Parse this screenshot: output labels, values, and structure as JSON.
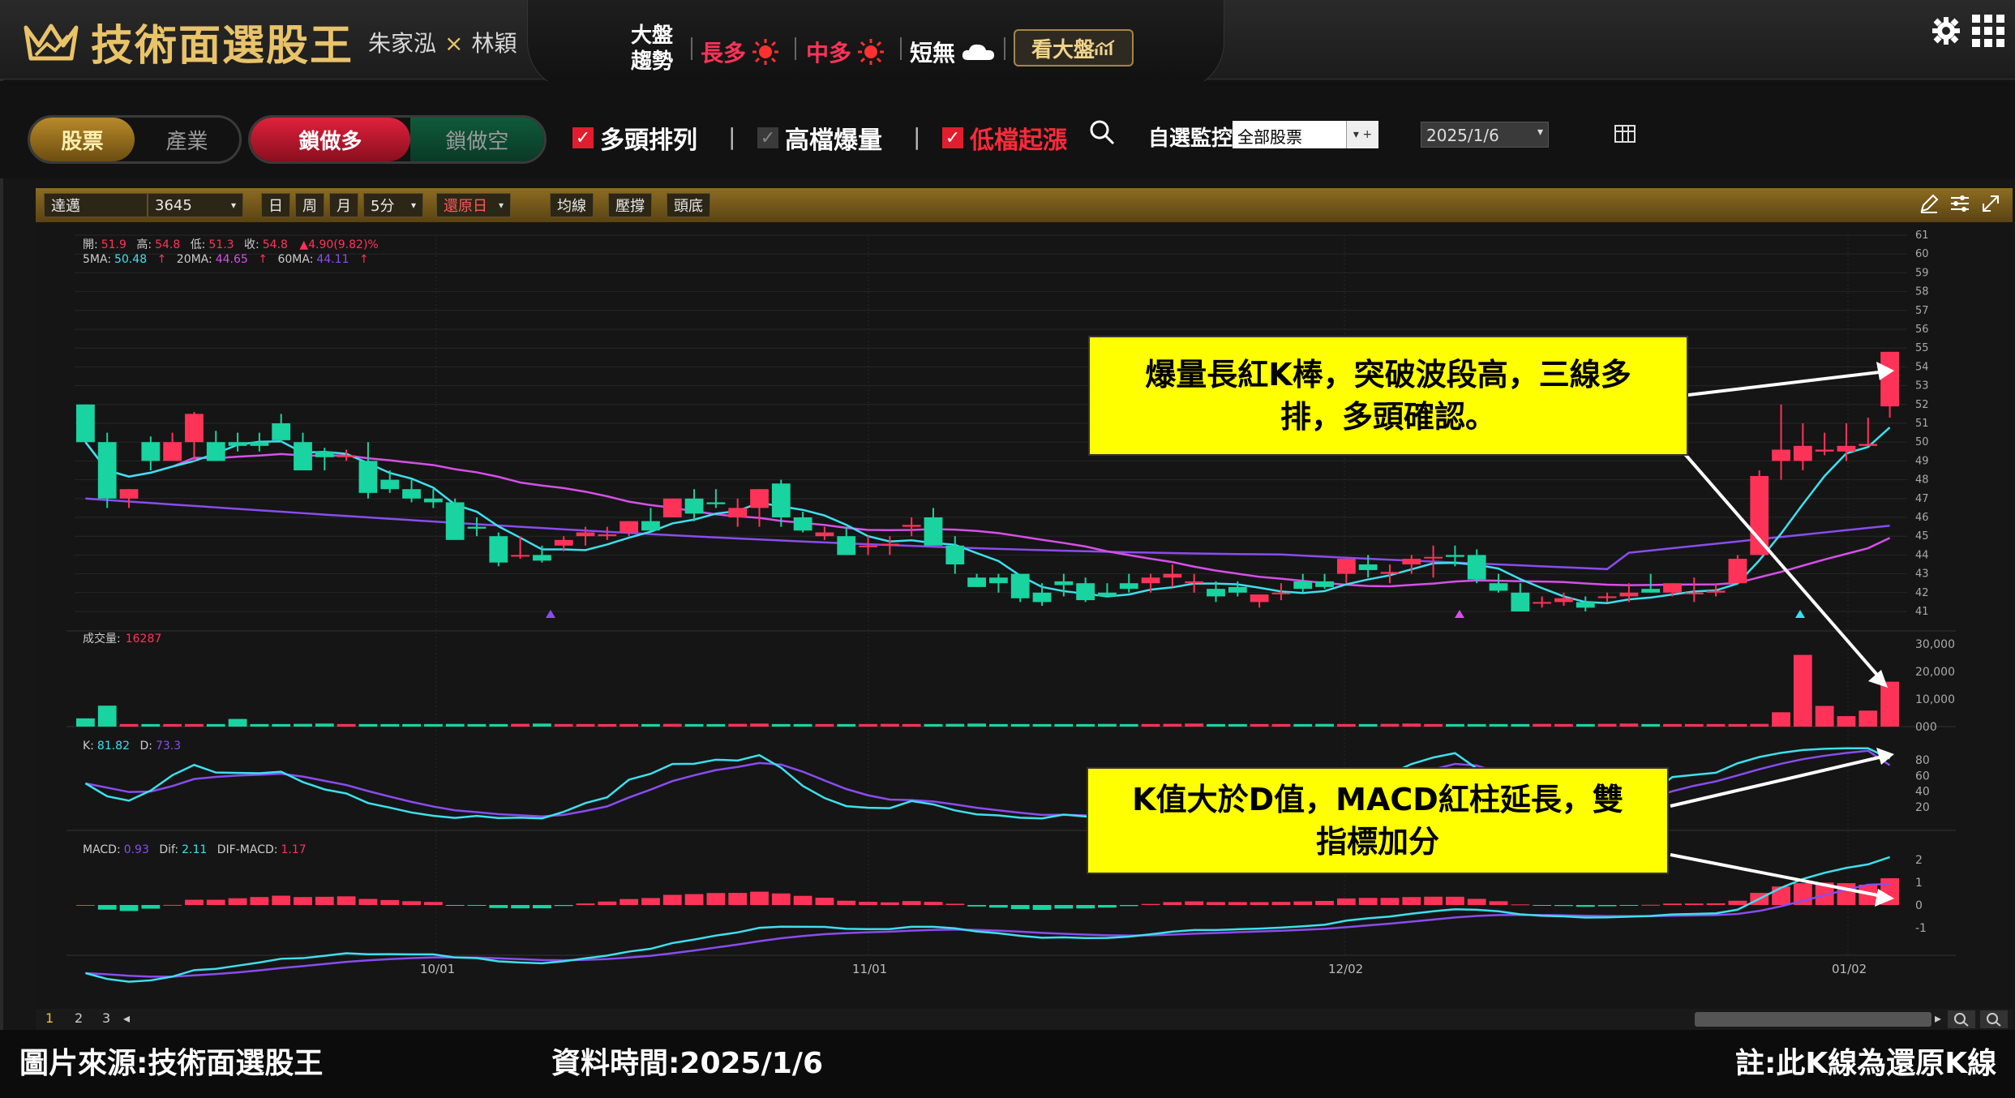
{
  "app": {
    "title": "技術面選股王",
    "author_a": "朱家泓",
    "author_x": "×",
    "author_b": "林穎"
  },
  "market": {
    "label_line1": "大盤",
    "label_line2": "趨勢",
    "long": "長多",
    "mid": "中多",
    "short": "短無",
    "see_button": "看大盤"
  },
  "tabs": {
    "stock": "股票",
    "industry": "產業",
    "lock_long": "鎖做多",
    "lock_short": "鎖做空"
  },
  "filters": {
    "bull_alignment": "多頭排列",
    "high_volume": "高檔爆量",
    "low_rise": "低檔起漲",
    "watch_label": "自選監控",
    "watch_value": "全部股票",
    "date_value": "2025/1/6"
  },
  "chart_toolbar": {
    "stock_name": "達邁",
    "stock_code": "3645",
    "day": "日",
    "week": "周",
    "month": "月",
    "interval": "5分",
    "restore": "還原日",
    "ma": "均線",
    "pressure": "壓撐",
    "top_bottom": "頭底"
  },
  "ohlc": {
    "open_label": "開:",
    "open": "51.9",
    "high_label": "高:",
    "high": "54.8",
    "low_label": "低:",
    "low": "51.3",
    "close_label": "收:",
    "close": "54.8",
    "change": "▲4.90(9.82)%",
    "ma5_label": "5MA:",
    "ma5": "50.48",
    "ma20_label": "20MA:",
    "ma20": "44.65",
    "ma60_label": "60MA:",
    "ma60": "44.11",
    "up_arrow": "↑"
  },
  "volume_info": {
    "label": "成交量:",
    "value": "16287"
  },
  "kd_info": {
    "k_label": "K:",
    "k": "81.82",
    "d_label": "D:",
    "d": "73.3"
  },
  "macd_info": {
    "macd_label": "MACD:",
    "macd": "0.93",
    "dif_label": "Dif:",
    "dif": "2.11",
    "osc_label": "DIF-MACD:",
    "osc": "1.17"
  },
  "price_axis": [
    "61",
    "60",
    "59",
    "58",
    "57",
    "56",
    "55",
    "54",
    "53",
    "52",
    "51",
    "50",
    "49",
    "48",
    "47",
    "46",
    "45",
    "44",
    "43",
    "42",
    "41"
  ],
  "volume_axis": [
    "30,000",
    "20,000",
    "10,000",
    "000"
  ],
  "kd_axis": [
    "80",
    "60",
    "40",
    "20"
  ],
  "macd_axis": [
    "2",
    "1",
    "0",
    "-1"
  ],
  "x_dates": [
    "10/01",
    "11/01",
    "12/02",
    "01/02"
  ],
  "pages": [
    "1",
    "2",
    "3"
  ],
  "callouts": {
    "top_line1": "爆量長紅K棒，突破波段高，三線多",
    "top_line2": "排，多頭確認。",
    "bottom_line1": "K值大於D值，MACD紅柱延長，雙",
    "bottom_line2": "指標加分"
  },
  "captions": {
    "source": "圖片來源:技術面選股王",
    "data_time": "資料時間:2025/1/6",
    "note": "註:此K線為還原K線"
  },
  "colors": {
    "up": "#ff3358",
    "down": "#19d3a0",
    "ma5": "#3de0ee",
    "ma20": "#d650e8",
    "ma60": "#8a4cf0",
    "gold": "#e9c36a"
  },
  "chart_data": {
    "type": "candlestick",
    "candles": [
      [
        52,
        52,
        50,
        50
      ],
      [
        50,
        50.5,
        46.5,
        47
      ],
      [
        47,
        47.5,
        46.5,
        47.5
      ],
      [
        50,
        50.3,
        48.5,
        49
      ],
      [
        49,
        50.5,
        49,
        50
      ],
      [
        50,
        51.6,
        49,
        51.5
      ],
      [
        50,
        50.6,
        49,
        49
      ],
      [
        50,
        50.5,
        49.5,
        49.8
      ],
      [
        50,
        50.5,
        49.5,
        49.8
      ],
      [
        51,
        51.5,
        50,
        50.1
      ],
      [
        50,
        50.5,
        48.5,
        48.5
      ],
      [
        49.5,
        49.7,
        48.5,
        49.2
      ],
      [
        49.2,
        49.6,
        49,
        49.3
      ],
      [
        49,
        50,
        47,
        47.3
      ],
      [
        48,
        48.5,
        47.3,
        47.5
      ],
      [
        47.5,
        48,
        46.8,
        47
      ],
      [
        47,
        47.5,
        46.5,
        46.8
      ],
      [
        46.8,
        47,
        45,
        44.8
      ],
      [
        45.5,
        46,
        45,
        45.4
      ],
      [
        45,
        45.2,
        43.4,
        43.6
      ],
      [
        44,
        45,
        43.8,
        44
      ],
      [
        44,
        44.5,
        43.6,
        43.7
      ],
      [
        44.5,
        45,
        44.2,
        44.8
      ],
      [
        45,
        45.5,
        44.5,
        45.2
      ],
      [
        45,
        45.5,
        44.8,
        45.1
      ],
      [
        45.2,
        45.8,
        45,
        45.8
      ],
      [
        45.8,
        46.5,
        45.3,
        45.3
      ],
      [
        46,
        47,
        46,
        47
      ],
      [
        47,
        47.5,
        45.8,
        46.2
      ],
      [
        46.8,
        47.5,
        46.5,
        46.7
      ],
      [
        46,
        47,
        45.5,
        46.5
      ],
      [
        46.5,
        47.5,
        45.5,
        47.5
      ],
      [
        47.8,
        48,
        45.5,
        46
      ],
      [
        46,
        46.3,
        45.2,
        45.3
      ],
      [
        45,
        45.5,
        44.8,
        45.2
      ],
      [
        45,
        45.5,
        44,
        44
      ],
      [
        44.5,
        45,
        44,
        44.5
      ],
      [
        44.5,
        45,
        44,
        44.6
      ],
      [
        45.5,
        46,
        45,
        45.6
      ],
      [
        46,
        46.5,
        44.8,
        44.5
      ],
      [
        44.5,
        45,
        43,
        43.5
      ],
      [
        42.8,
        43,
        42.3,
        42.3
      ],
      [
        42.8,
        43,
        42,
        42.5
      ],
      [
        43,
        43,
        41.5,
        41.7
      ],
      [
        42,
        42.5,
        41.3,
        41.5
      ],
      [
        42.6,
        43,
        41.8,
        42.4
      ],
      [
        42.5,
        42.8,
        41.5,
        41.6
      ],
      [
        42,
        42.5,
        41.8,
        41.8
      ],
      [
        42.5,
        43,
        42,
        42.2
      ],
      [
        42.5,
        43,
        42,
        42.8
      ],
      [
        42.8,
        43.5,
        42.3,
        43
      ],
      [
        42.5,
        43,
        42,
        42.6
      ],
      [
        42.2,
        42.6,
        41.5,
        41.8
      ],
      [
        42.3,
        42.6,
        41.8,
        42
      ],
      [
        41.5,
        41.8,
        41.2,
        41.9
      ],
      [
        42,
        42.5,
        41.6,
        42
      ],
      [
        42.6,
        43,
        42,
        42.2
      ],
      [
        42.6,
        43,
        42.2,
        42.3
      ],
      [
        43,
        43.5,
        42.5,
        43.8
      ],
      [
        43.5,
        44,
        42.8,
        43.2
      ],
      [
        43,
        43.5,
        42.5,
        43.1
      ],
      [
        43.5,
        44,
        43,
        43.8
      ],
      [
        43.9,
        44.5,
        42.8,
        43.9
      ],
      [
        44,
        44.5,
        43.4,
        43.9
      ],
      [
        44,
        44.3,
        42.5,
        42.7
      ],
      [
        42.5,
        43,
        42,
        42.1
      ],
      [
        42,
        42.5,
        41,
        41
      ],
      [
        41.5,
        41.8,
        41.2,
        41.5
      ],
      [
        41.5,
        42,
        41.3,
        41.7
      ],
      [
        41.5,
        41.8,
        41,
        41.2
      ],
      [
        41.8,
        42,
        41.5,
        41.8
      ],
      [
        41.8,
        42.5,
        41.5,
        42
      ],
      [
        42.2,
        43,
        42,
        42
      ],
      [
        42,
        42.5,
        41.8,
        42.5
      ],
      [
        42,
        42.8,
        41.5,
        42
      ],
      [
        42,
        42.5,
        41.8,
        42.1
      ],
      [
        42.5,
        44,
        42.5,
        43.8
      ],
      [
        44,
        48.5,
        44,
        48.2
      ],
      [
        49,
        52,
        48,
        49.6
      ],
      [
        49,
        51,
        48.5,
        49.8
      ],
      [
        49.5,
        50.5,
        49.3,
        49.6
      ],
      [
        49.5,
        51,
        49,
        49.8
      ],
      [
        49.8,
        51.3,
        49.8,
        49.9
      ],
      [
        51.9,
        54.8,
        51.3,
        54.8
      ]
    ],
    "volume": [
      3000,
      6500,
      900,
      900,
      800,
      900,
      900,
      2500,
      900,
      900
    ],
    "kd": {
      "k_last": 81.82,
      "d_last": 73.3
    },
    "macd": {
      "macd": 0.93,
      "dif": 2.11,
      "osc": 1.17
    },
    "price_range": [
      41,
      61
    ]
  }
}
